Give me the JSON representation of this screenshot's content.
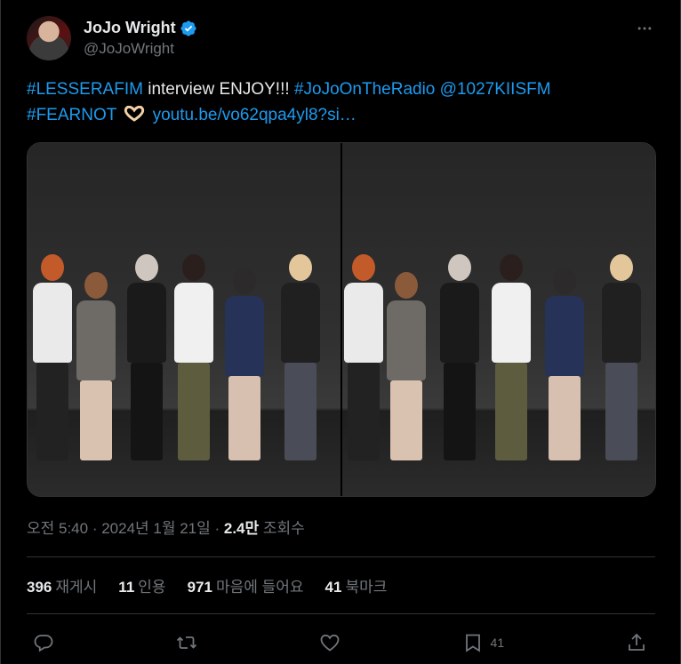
{
  "user": {
    "display_name": "JoJo Wright",
    "handle": "@JoJoWright"
  },
  "tweet": {
    "hashtag1": "#LESSERAFIM",
    "text1": " interview ENJOY!!! ",
    "hashtag2": "#JoJoOnTheRadio",
    "mention": "@1027KIISFM",
    "hashtag3": "#FEARNOT",
    "link": "youtu.be/vo62qpa4yl8?si…"
  },
  "meta": {
    "time": "오전 5:40",
    "sep1": " · ",
    "date": "2024년 1월 21일",
    "sep2": " · ",
    "views_value": "2.4만",
    "views_label": " 조회수"
  },
  "stats": [
    {
      "value": "396",
      "label": "재게시"
    },
    {
      "value": "11",
      "label": "인용"
    },
    {
      "value": "971",
      "label": "마음에 들어요"
    },
    {
      "value": "41",
      "label": "북마크"
    }
  ],
  "actions": {
    "bookmark_count": "41"
  },
  "icons": {
    "verified": "verified-badge-icon",
    "more": "more-dots-icon",
    "reply": "reply-icon",
    "retweet": "repost-icon",
    "like": "heart-icon",
    "bookmark": "bookmark-icon",
    "share": "share-icon"
  },
  "colors": {
    "link": "#1d9bf0",
    "text": "#e7e9ea",
    "muted": "#71767b",
    "background": "#000000",
    "border": "#2f3336"
  }
}
